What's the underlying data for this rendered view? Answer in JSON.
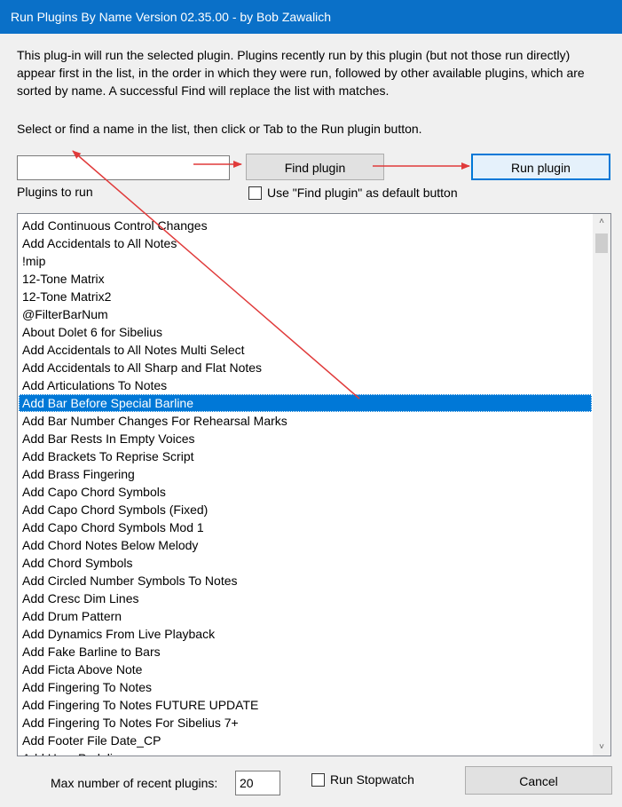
{
  "window": {
    "title": "Run Plugins By Name  Version 02.35.00 - by Bob Zawalich"
  },
  "description": "This plug-in will run the selected plugin. Plugins recently run by this plugin (but not those run directly) appear first in the list, in the order in which they were run, followed by other available plugins, which are sorted by name. A successful Find will replace the list with matches.",
  "instruction": "Select or find a name in the list, then click or Tab to the Run plugin button.",
  "search": {
    "value": "",
    "placeholder": ""
  },
  "buttons": {
    "find": "Find plugin",
    "run": "Run plugin",
    "cancel": "Cancel"
  },
  "plugins_label": "Plugins to run",
  "default_button_checkbox": {
    "label": "Use \"Find plugin\" as default button",
    "checked": false
  },
  "plugin_list": {
    "selected_index": 10,
    "items": [
      "Add Continuous Control Changes",
      "Add Accidentals to All Notes",
      "!mip",
      "12-Tone Matrix",
      "12-Tone Matrix2",
      "@FilterBarNum",
      "About Dolet 6 for Sibelius",
      "Add Accidentals to All Notes Multi Select",
      "Add Accidentals to All Sharp and Flat Notes",
      "Add Articulations To Notes",
      "Add Bar Before Special Barline",
      "Add Bar Number Changes For Rehearsal Marks",
      "Add Bar Rests In Empty Voices",
      "Add Brackets To Reprise Script",
      "Add Brass Fingering",
      "Add Capo Chord Symbols",
      "Add Capo Chord Symbols (Fixed)",
      "Add Capo Chord Symbols Mod 1",
      "Add Chord Notes Below Melody",
      "Add Chord Symbols",
      "Add Circled Number Symbols To Notes",
      "Add Cresc Dim Lines",
      "Add Drum Pattern",
      "Add Dynamics From Live Playback",
      "Add Fake Barline to Bars",
      "Add Ficta Above Note",
      "Add Fingering To Notes",
      "Add Fingering To Notes FUTURE UPDATE",
      "Add Fingering To Notes For Sibelius 7+",
      "Add Footer File Date_CP",
      "Add Harp Pedaling"
    ]
  },
  "footer": {
    "recent_label": "Max number of recent plugins:",
    "recent_value": "20",
    "stopwatch_label": "Run Stopwatch",
    "stopwatch_checked": false
  },
  "icons": {
    "scroll_up": "chevron-up-icon",
    "scroll_down": "chevron-down-icon"
  },
  "colors": {
    "titlebar": "#0a70c8",
    "selection": "#0078d7",
    "annotation_arrows": "#e03a3a"
  }
}
